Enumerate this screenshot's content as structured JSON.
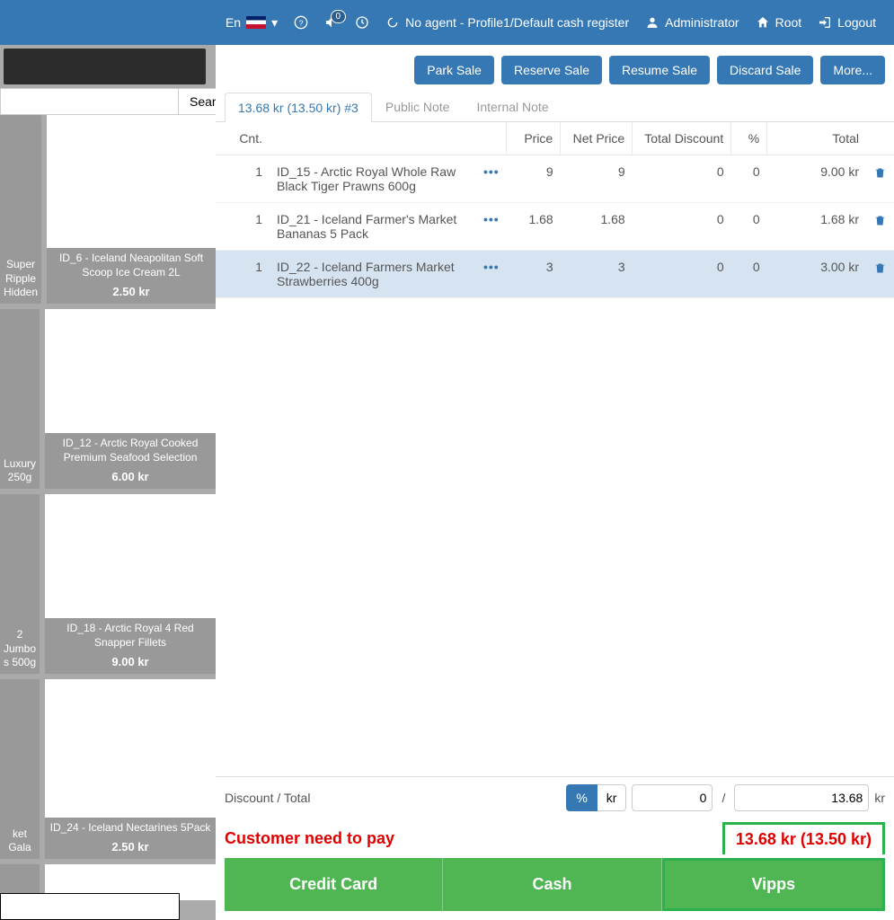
{
  "topbar": {
    "lang": "En",
    "notification_count": "0",
    "agent_text": "No agent - Profile1/Default cash register",
    "user": "Administrator",
    "root": "Root",
    "logout": "Logout"
  },
  "search": {
    "button": "Search"
  },
  "products": [
    {
      "partial_name": "Super Ripple Hidden",
      "name": "ID_6 - Iceland Neapolitan Soft Scoop Ice Cream 2L",
      "price": "2.50 kr"
    },
    {
      "partial_name": "Luxury 250g",
      "name": "ID_12 - Arctic Royal Cooked Premium Seafood Selection",
      "price": "6.00 kr"
    },
    {
      "partial_name": "2 Jumbo s 500g",
      "name": "ID_18 - Arctic Royal 4 Red Snapper Fillets",
      "price": "9.00 kr"
    },
    {
      "partial_name": "ket Gala",
      "name": "ID_24 - Iceland Nectarines 5Pack",
      "price": "2.50 kr"
    }
  ],
  "actions": {
    "park": "Park Sale",
    "reserve": "Reserve Sale",
    "resume": "Resume Sale",
    "discard": "Discard Sale",
    "more": "More..."
  },
  "tabs": {
    "active": "13.68 kr (13.50 kr) #3",
    "public_note": "Public Note",
    "internal_note": "Internal Note"
  },
  "cart_headers": {
    "cnt": "Cnt.",
    "price": "Price",
    "net": "Net Price",
    "disc": "Total Discount",
    "pct": "%",
    "total": "Total"
  },
  "cart": [
    {
      "cnt": "1",
      "name": "ID_15 - Arctic Royal Whole Raw Black Tiger Prawns 600g",
      "price": "9",
      "net": "9",
      "disc": "0",
      "pct": "0",
      "total": "9.00 kr",
      "hl": false
    },
    {
      "cnt": "1",
      "name": "ID_21 - Iceland Farmer's Market Bananas 5 Pack",
      "price": "1.68",
      "net": "1.68",
      "disc": "0",
      "pct": "0",
      "total": "1.68 kr",
      "hl": false
    },
    {
      "cnt": "1",
      "name": "ID_22 - Iceland Farmers Market Strawberries 400g",
      "price": "3",
      "net": "3",
      "disc": "0",
      "pct": "0",
      "total": "3.00 kr",
      "hl": true
    }
  ],
  "discount": {
    "label": "Discount / Total",
    "pct": "%",
    "kr": "kr",
    "discount_value": "0",
    "slash": "/",
    "total_value": "13.68",
    "suffix": "kr"
  },
  "payment": {
    "label": "Customer need to pay",
    "amount": "13.68 kr (13.50 kr)",
    "credit": "Credit Card",
    "cash": "Cash",
    "vipps": "Vipps"
  }
}
